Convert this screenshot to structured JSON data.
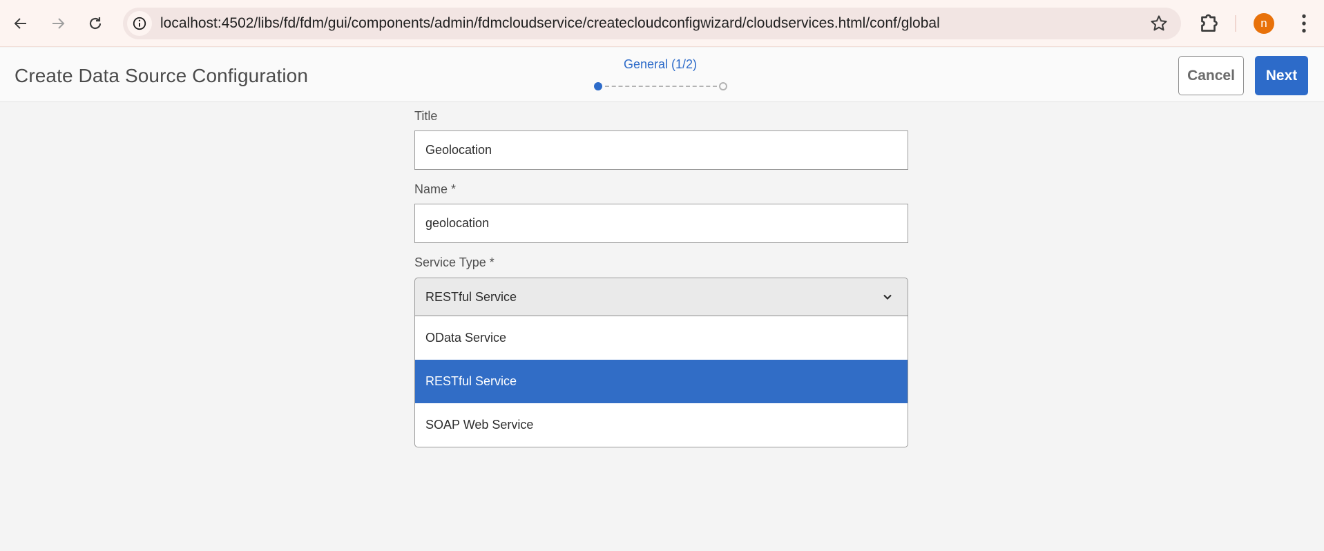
{
  "browser": {
    "url": "localhost:4502/libs/fd/fdm/gui/components/admin/fdmcloudservice/createcloudconfigwizard/cloudservices.html/conf/global",
    "profile_initial": "n",
    "icons": {
      "back": "arrow-left-icon",
      "forward": "arrow-right-icon",
      "reload": "reload-icon",
      "site_info": "info-icon",
      "bookmark": "star-icon",
      "extensions": "puzzle-icon",
      "menu": "kebab-menu-icon"
    }
  },
  "header": {
    "title": "Create Data Source Configuration",
    "wizard_step": "General (1/2)",
    "current_step": 1,
    "total_steps": 2,
    "cancel_label": "Cancel",
    "next_label": "Next",
    "accent_color": "#2d6bc9"
  },
  "form": {
    "title_field": {
      "label": "Title",
      "value": "Geolocation"
    },
    "name_field": {
      "label": "Name *",
      "value": "geolocation"
    },
    "service_type": {
      "label": "Service Type *",
      "selected": "RESTful Service",
      "options": [
        {
          "label": "OData Service",
          "selected": false
        },
        {
          "label": "RESTful Service",
          "selected": true
        },
        {
          "label": "SOAP Web Service",
          "selected": false
        }
      ]
    }
  }
}
